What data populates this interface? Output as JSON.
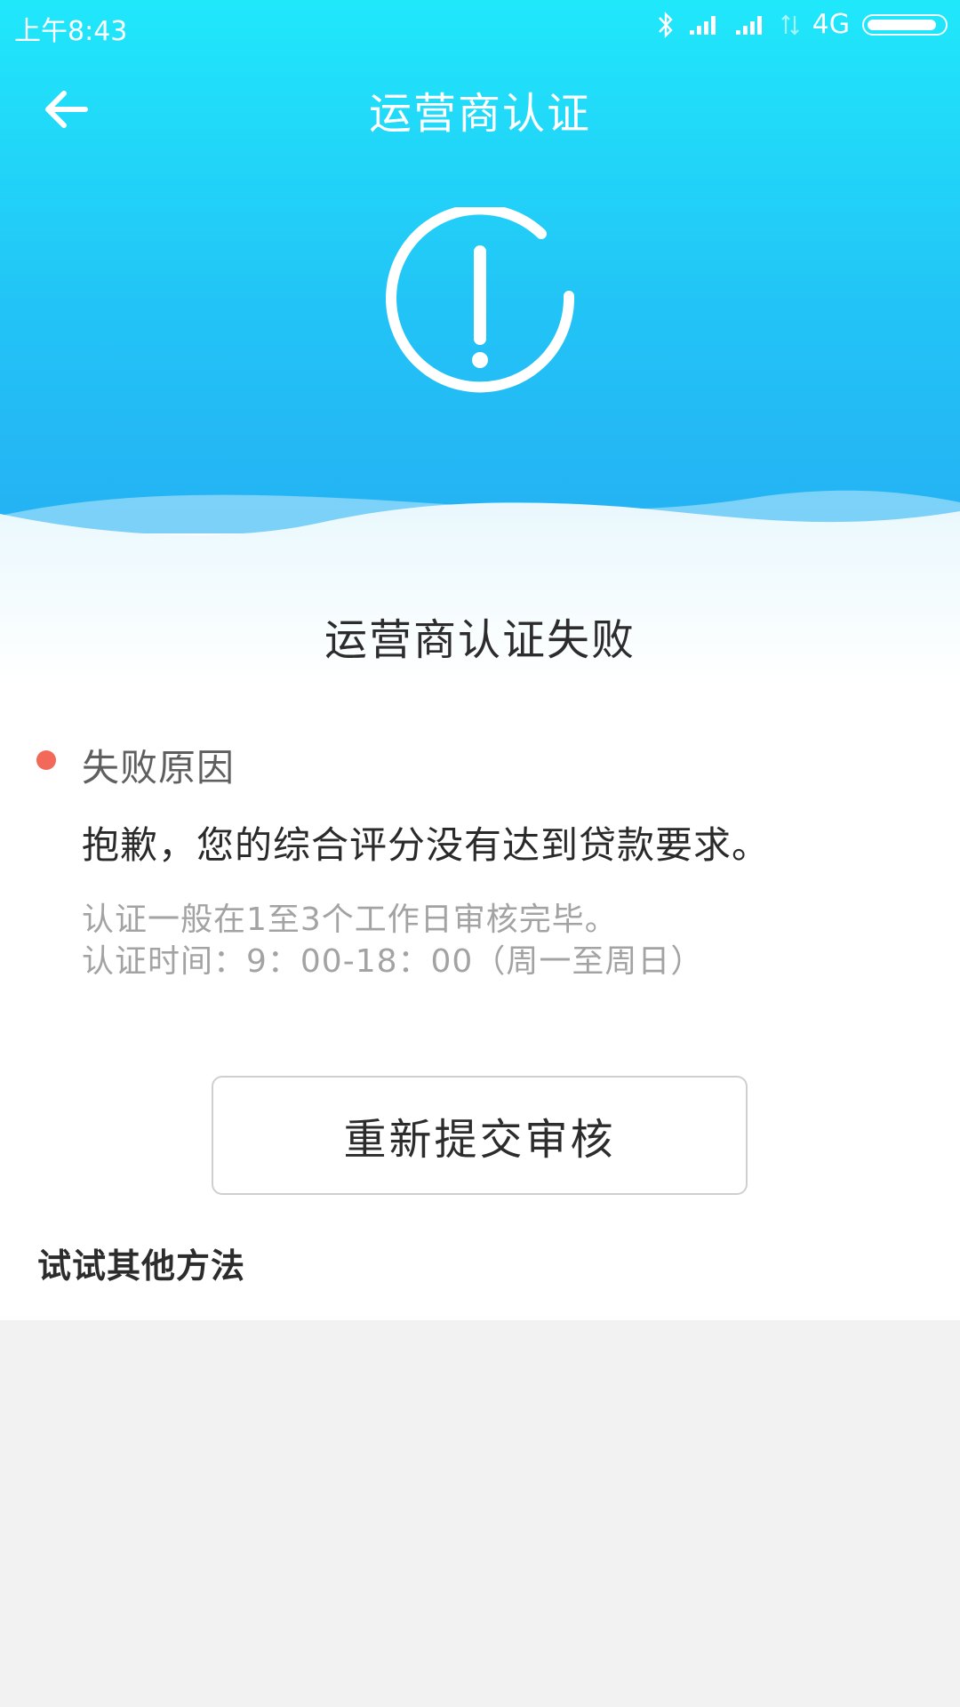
{
  "status_bar": {
    "time": "上午8:43",
    "network": "4G",
    "battery_level": 0.92
  },
  "header": {
    "title": "运营商认证"
  },
  "result": {
    "title": "运营商认证失败"
  },
  "reason": {
    "label": "失败原因",
    "text": "抱歉，您的综合评分没有达到贷款要求。"
  },
  "info": {
    "line1": "认证一般在1至3个工作日审核完毕。",
    "line2": "认证时间：9：00-18：00（周一至周日）"
  },
  "actions": {
    "resubmit_label": "重新提交审核",
    "other_methods_label": "试试其他方法"
  },
  "colors": {
    "header_top": "#20e8fb",
    "header_bottom": "#25b0f4",
    "reason_dot": "#f2695a",
    "page_bg": "#f2f2f2"
  },
  "icons": {
    "back": "arrow-left-icon",
    "status": "alert-circle-icon",
    "bluetooth": "bluetooth-icon",
    "signal": "signal-icon",
    "battery": "battery-icon"
  }
}
